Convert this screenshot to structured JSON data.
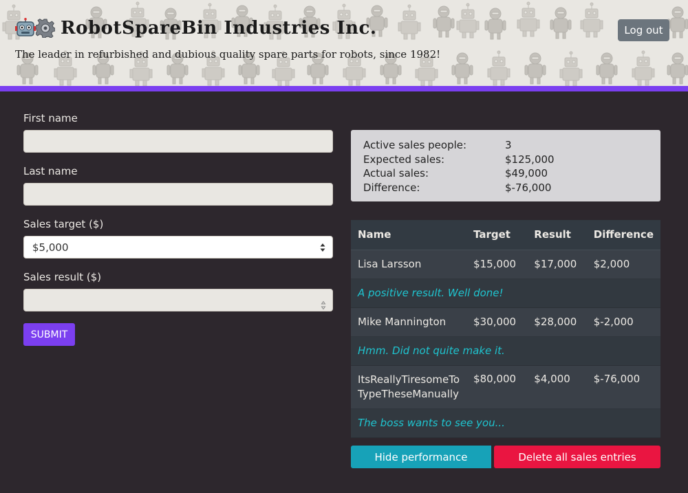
{
  "header": {
    "title": "RobotSpareBin Industries Inc.",
    "tagline": "The leader in refurbished and dubious quality spare parts for robots, since 1982!",
    "logout_label": "Log out",
    "icons": [
      "robot-icon",
      "gear-icon"
    ]
  },
  "form": {
    "first_name": {
      "label": "First name",
      "value": ""
    },
    "last_name": {
      "label": "Last name",
      "value": ""
    },
    "sales_target": {
      "label": "Sales target ($)",
      "selected": "$5,000"
    },
    "sales_result": {
      "label": "Sales result ($)",
      "value": ""
    },
    "submit_label": "SUBMIT"
  },
  "summary": {
    "rows": [
      {
        "key": "Active sales people:",
        "value": "3"
      },
      {
        "key": "Expected sales:",
        "value": "$125,000"
      },
      {
        "key": "Actual sales:",
        "value": "$49,000"
      },
      {
        "key": "Difference:",
        "value": "$-76,000"
      }
    ]
  },
  "table": {
    "headers": [
      "Name",
      "Target",
      "Result",
      "Difference"
    ],
    "rows": [
      {
        "name": "Lisa Larsson",
        "target": "$15,000",
        "result": "$17,000",
        "difference": "$2,000",
        "comment": "A positive result. Well done!"
      },
      {
        "name": "Mike Mannington",
        "target": "$30,000",
        "result": "$28,000",
        "difference": "$-2,000",
        "comment": "Hmm. Did not quite make it."
      },
      {
        "name_line1": "ItsReallyTiresomeTo",
        "name_line2": "TypeTheseManually",
        "target": "$80,000",
        "result": "$4,000",
        "difference": "$-76,000",
        "comment": "The boss wants to see you..."
      }
    ]
  },
  "actions": {
    "hide_label": "Hide performance",
    "delete_label": "Delete all sales entries"
  },
  "colors": {
    "accent": "#7b3ff0",
    "background": "#2d272d",
    "info": "#17a2b8",
    "danger": "#ea1541",
    "comment_text": "#1fc4cf"
  }
}
